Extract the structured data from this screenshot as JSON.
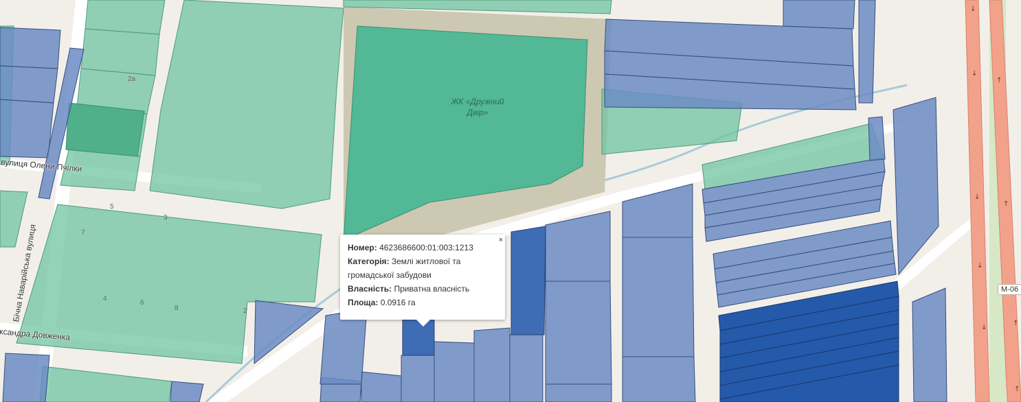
{
  "map": {
    "street_labels": [
      "вулиця Олени Пчілки",
      "Бічна Наварійська вулиця",
      "ксандра Довженка"
    ],
    "house_numbers": [
      "5",
      "3",
      "7",
      "2а",
      "4",
      "6",
      "8",
      "2"
    ],
    "area_name_line1": "ЖК «Дружний",
    "area_name_line2": "Двір»",
    "road_shield": "М-06",
    "colors": {
      "residential_parcel": "#6fc4a0",
      "selected_parcel": "#3f6db5",
      "private_parcel": "#6c8cc4",
      "dark_parcel": "#2559aa",
      "highway": "#f2a28b",
      "compound": "#cdc8b2"
    }
  },
  "popup": {
    "number_label": "Номер:",
    "number_value": "4623686600:01:003:1213",
    "category_label": "Категорія:",
    "category_value": "Землі житлової та громадської забудови",
    "ownership_label": "Власність:",
    "ownership_value": "Приватна власність",
    "area_label": "Площа:",
    "area_value": "0.0916 га",
    "close_glyph": "×"
  }
}
